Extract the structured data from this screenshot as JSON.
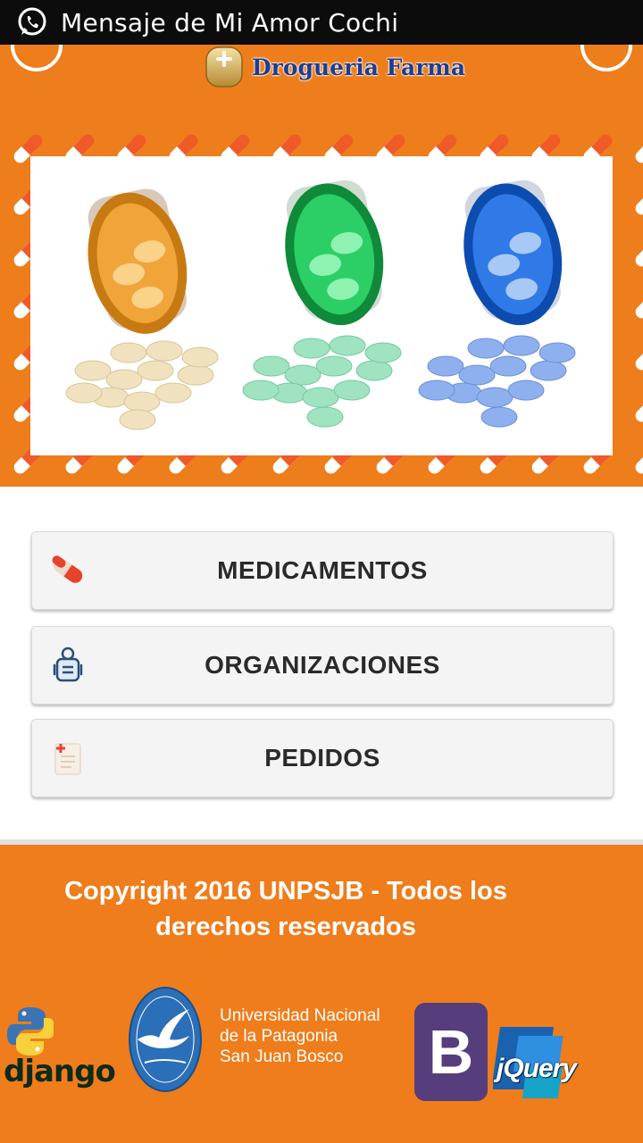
{
  "notification": {
    "app_icon": "whatsapp-icon",
    "text": "Mensaje de Mi Amor Cochi"
  },
  "header": {
    "brand_name": "Drogueria Farma",
    "left_button_icon": "home-icon",
    "right_button_icon": "more-icon",
    "banner_image": "pill-bottles-photo"
  },
  "menu": {
    "items": [
      {
        "label": "MEDICAMENTOS",
        "icon": "pill-icon"
      },
      {
        "label": "ORGANIZACIONES",
        "icon": "pharmacist-icon"
      },
      {
        "label": "PEDIDOS",
        "icon": "clipboard-icon"
      }
    ]
  },
  "footer": {
    "copyright_line1": "Copyright 2016 UNPSJB - Todos los",
    "copyright_line2": "derechos reservados",
    "django_label": "django",
    "university_line1": "Universidad Nacional",
    "university_line2": "de la Patagonia",
    "university_line3": "San Juan Bosco",
    "bootstrap_letter": "B",
    "jquery_label": "jQuery"
  },
  "colors": {
    "primary_orange": "#ee7d1b",
    "brand_blue": "#1e3d8f",
    "bootstrap_purple": "#563d7c"
  }
}
